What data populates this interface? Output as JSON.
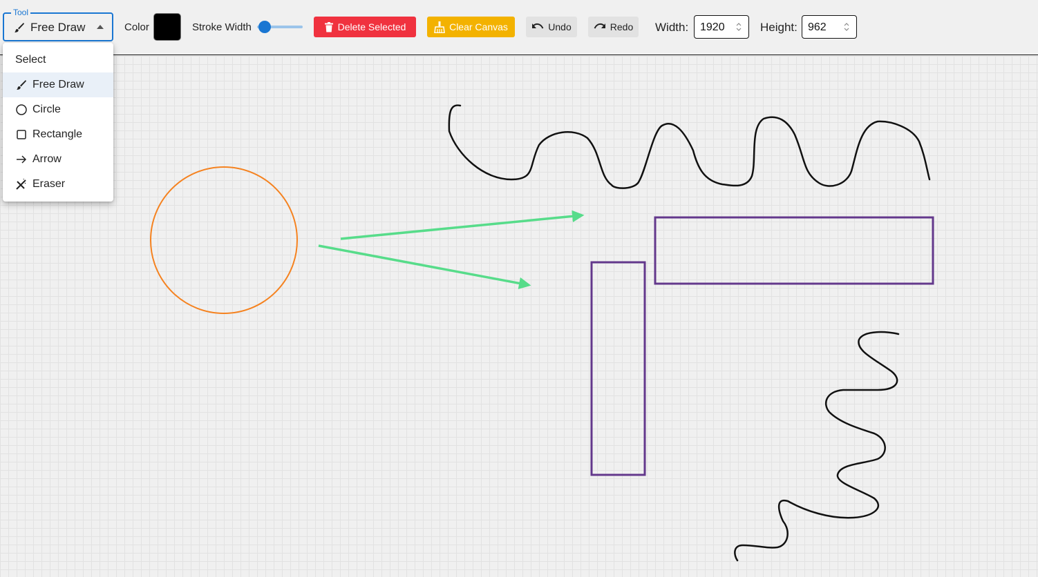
{
  "toolbar": {
    "tool": {
      "legend": "Tool",
      "value": "Free Draw",
      "icon": "brush-icon"
    },
    "color_label": "Color",
    "color_value": "#000000",
    "stroke_label": "Stroke Width",
    "stroke_level": 0.17,
    "delete_label": "Delete Selected",
    "clear_label": "Clear Canvas",
    "undo_label": "Undo",
    "redo_label": "Redo",
    "width_label": "Width:",
    "width_value": "1920",
    "height_label": "Height:",
    "height_value": "962"
  },
  "tool_menu": {
    "items": [
      {
        "label": "Select",
        "icon": ""
      },
      {
        "label": "Free Draw",
        "icon": "brush-icon",
        "selected": true
      },
      {
        "label": "Circle",
        "icon": "circle-icon"
      },
      {
        "label": "Rectangle",
        "icon": "square-icon"
      },
      {
        "label": "Arrow",
        "icon": "arrow-right-icon"
      },
      {
        "label": "Eraser",
        "icon": "eraser-icon"
      }
    ]
  },
  "colors": {
    "accent": "#1976d2",
    "delete": "#f0323f",
    "clear": "#f3b200",
    "circle": "#f5821f",
    "arrows": "#57dc8a",
    "rectangles": "#63388c",
    "freehand": "#000000"
  }
}
